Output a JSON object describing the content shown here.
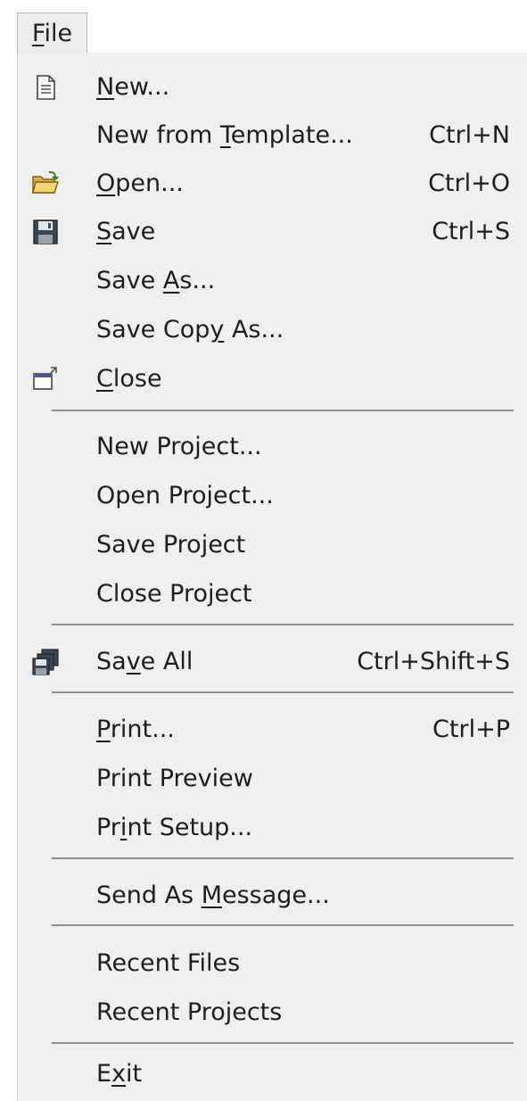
{
  "menubar": {
    "file_label": "File",
    "file_mnemonic": "F",
    "file_rest": "ile"
  },
  "menu": {
    "new": {
      "pre": "",
      "mn": "N",
      "post": "ew...",
      "shortcut": ""
    },
    "new_template": {
      "pre": "New from ",
      "mn": "T",
      "post": "emplate...",
      "shortcut": "Ctrl+N"
    },
    "open": {
      "pre": "",
      "mn": "O",
      "post": "pen...",
      "shortcut": "Ctrl+O"
    },
    "save": {
      "pre": "",
      "mn": "S",
      "post": "ave",
      "shortcut": "Ctrl+S"
    },
    "save_as": {
      "pre": "Save ",
      "mn": "A",
      "post": "s...",
      "shortcut": ""
    },
    "save_copy_as": {
      "pre": "Save Cop",
      "mn": "y",
      "post": " As...",
      "shortcut": ""
    },
    "close": {
      "pre": "",
      "mn": "C",
      "post": "lose",
      "shortcut": ""
    },
    "new_project": {
      "label": "New Project..."
    },
    "open_project": {
      "label": "Open Project..."
    },
    "save_project": {
      "label": "Save Project"
    },
    "close_project": {
      "label": "Close Project"
    },
    "save_all": {
      "pre": "Sa",
      "mn": "v",
      "post": "e All",
      "shortcut": "Ctrl+Shift+S"
    },
    "print": {
      "pre": "",
      "mn": "P",
      "post": "rint...",
      "shortcut": "Ctrl+P"
    },
    "print_preview": {
      "label": "Print Preview"
    },
    "print_setup": {
      "pre": "Pr",
      "mn": "i",
      "post": "nt Setup...",
      "shortcut": ""
    },
    "send_as_message": {
      "pre": "Send As ",
      "mn": "M",
      "post": "essage...",
      "shortcut": ""
    },
    "recent_files": {
      "label": "Recent Files"
    },
    "recent_projects": {
      "label": "Recent Projects"
    },
    "exit": {
      "pre": "E",
      "mn": "x",
      "post": "it"
    }
  },
  "icons": {
    "new": "new-document-icon",
    "open": "open-folder-icon",
    "save": "floppy-disk-icon",
    "close": "close-window-icon",
    "save_all": "save-all-icon"
  }
}
